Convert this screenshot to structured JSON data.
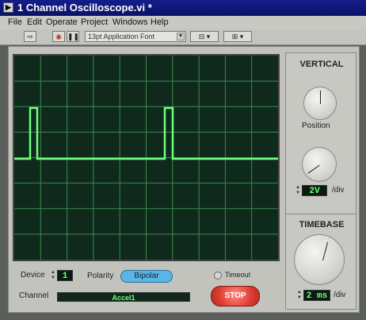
{
  "window": {
    "title": "1 Channel Oscilloscope.vi *"
  },
  "menu": [
    "File",
    "Edit",
    "Operate",
    "Project",
    "Windows",
    "Help"
  ],
  "toolbar": {
    "font": "13pt Application Font"
  },
  "colors": {
    "trace": "#6dff7a",
    "grid": "#3c8a4f",
    "screen": "#0f2a1c",
    "stop": "#e23c32",
    "bipolar": "#5ab6e6"
  },
  "vertical": {
    "title": "VERTICAL",
    "position_label": "Position",
    "volts": "2V",
    "volts_unit": "/div"
  },
  "timebase": {
    "title": "TIMEBASE",
    "time": "2 ms",
    "time_unit": "/div"
  },
  "controls": {
    "device_label": "Device",
    "device_value": "1",
    "polarity_label": "Polarity",
    "polarity_value": "Bipolar",
    "timeout_label": "Timeout",
    "channel_label": "Channel",
    "channel_value": "Accel1",
    "stop_label": "STOP"
  }
}
